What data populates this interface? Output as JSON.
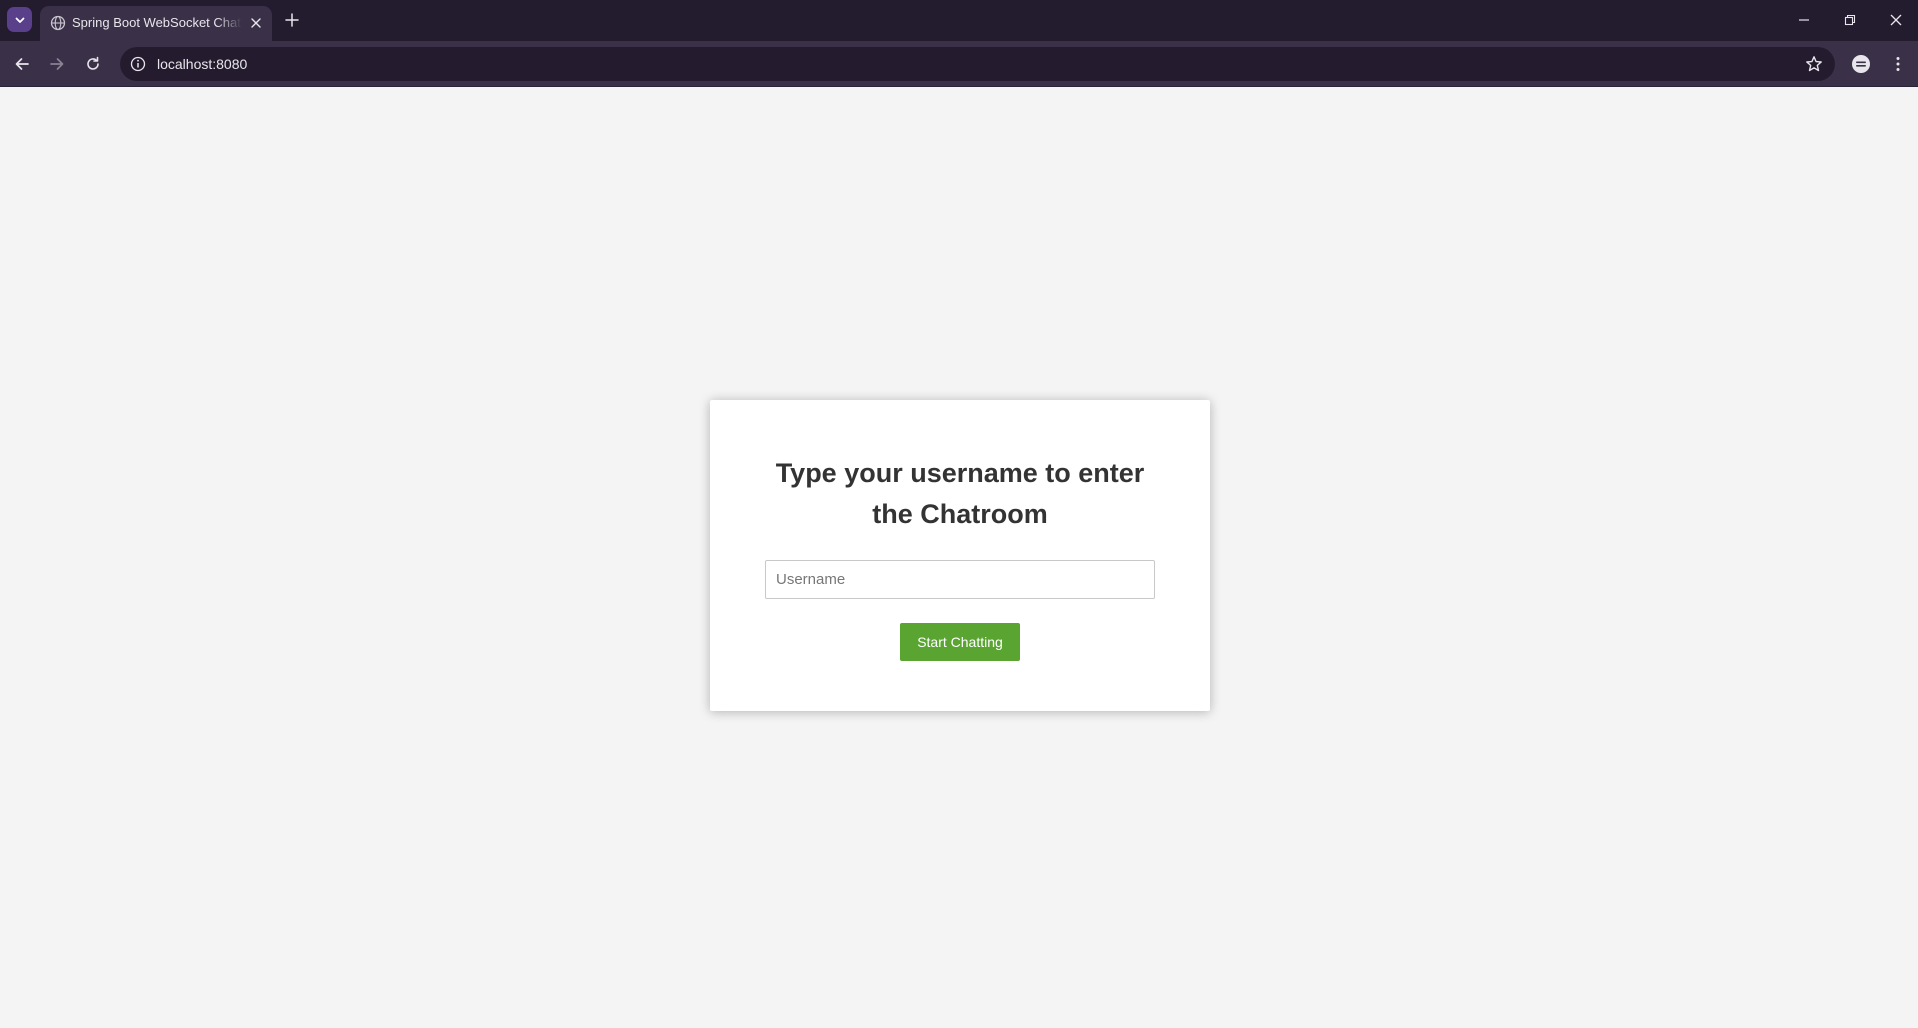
{
  "browser": {
    "tab_title": "Spring Boot WebSocket Chat Application",
    "url": "localhost:8080",
    "icons": {
      "tab_menu": "chevron-down-icon",
      "favicon": "globe-icon",
      "tab_close": "close-icon",
      "new_tab": "plus-icon",
      "minimize": "minimize-icon",
      "restore": "restore-icon",
      "close_window": "close-icon",
      "back": "arrow-left-icon",
      "forward": "arrow-right-icon",
      "reload": "reload-icon",
      "site_info": "info-icon",
      "bookmark": "star-icon",
      "profile": "profile-icon",
      "menu": "kebab-icon"
    },
    "colors": {
      "tabbar": "#231b2e",
      "toolbar": "#3a3148",
      "omnibox": "#241c2e",
      "tab_menu_accent": "#5a3f8a"
    }
  },
  "page": {
    "title": "Type your username to enter the Chatroom",
    "username_placeholder": "Username",
    "username_value": "",
    "start_button_label": "Start Chatting",
    "colors": {
      "background": "#f4f4f4",
      "card": "#ffffff",
      "button": "#5aa532",
      "title_text": "#333333"
    }
  }
}
